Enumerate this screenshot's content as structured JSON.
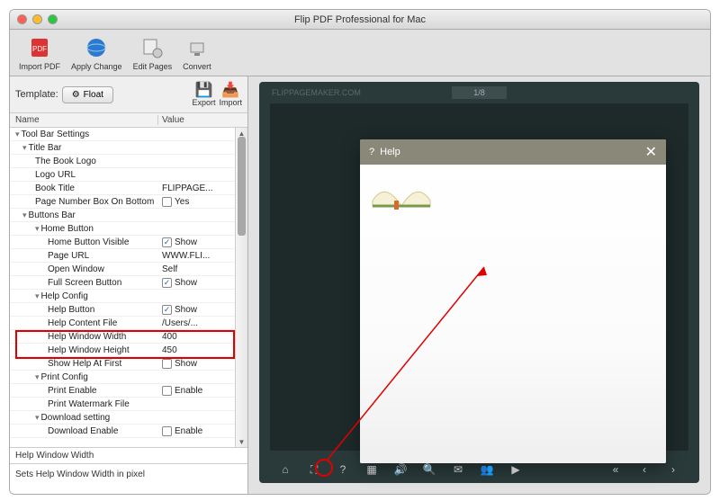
{
  "window": {
    "title": "Flip PDF Professional for Mac"
  },
  "toolbar": [
    {
      "name": "import-pdf",
      "label": "Import PDF",
      "iconColor": "#d33"
    },
    {
      "name": "apply-change",
      "label": "Apply Change",
      "iconColor": "#2a7ad3"
    },
    {
      "name": "edit-pages",
      "label": "Edit Pages",
      "iconColor": "#7a7a7a"
    },
    {
      "name": "convert",
      "label": "Convert",
      "iconColor": "#7a7a7a"
    }
  ],
  "template": {
    "label": "Template:",
    "current": "Float",
    "export": "Export",
    "import": "Import"
  },
  "tree": {
    "headers": {
      "name": "Name",
      "value": "Value"
    },
    "rows": [
      {
        "name": "Tool Bar Settings",
        "indent": 0,
        "expander": "open"
      },
      {
        "name": "Title Bar",
        "indent": 1,
        "expander": "open"
      },
      {
        "name": "The Book Logo",
        "indent": 2
      },
      {
        "name": "Logo URL",
        "indent": 2
      },
      {
        "name": "Book Title",
        "indent": 2,
        "value": "FLIPPAGE..."
      },
      {
        "name": "Page Number Box On Bottom",
        "indent": 2,
        "checkbox": false,
        "checklabel": "Yes"
      },
      {
        "name": "Buttons Bar",
        "indent": 1,
        "expander": "open"
      },
      {
        "name": "Home Button",
        "indent": 2,
        "expander": "open"
      },
      {
        "name": "Home Button Visible",
        "indent": 3,
        "checkbox": true,
        "checklabel": "Show"
      },
      {
        "name": "Page URL",
        "indent": 3,
        "value": "WWW.FLI..."
      },
      {
        "name": "Open Window",
        "indent": 3,
        "value": "Self"
      },
      {
        "name": "Full Screen Button",
        "indent": 3,
        "checkbox": true,
        "checklabel": "Show"
      },
      {
        "name": "Help Config",
        "indent": 2,
        "expander": "open"
      },
      {
        "name": "Help Button",
        "indent": 3,
        "checkbox": true,
        "checklabel": "Show"
      },
      {
        "name": "Help Content File",
        "indent": 3,
        "value": "/Users/..."
      },
      {
        "name": "Help Window Width",
        "indent": 3,
        "value": "400"
      },
      {
        "name": "Help Window Height",
        "indent": 3,
        "value": "450"
      },
      {
        "name": "Show Help At First",
        "indent": 3,
        "checkbox": false,
        "checklabel": "Show"
      },
      {
        "name": "Print Config",
        "indent": 2,
        "expander": "open"
      },
      {
        "name": "Print Enable",
        "indent": 3,
        "checkbox": false,
        "checklabel": "Enable"
      },
      {
        "name": "Print Watermark File",
        "indent": 3
      },
      {
        "name": "Download setting",
        "indent": 2,
        "expander": "open"
      },
      {
        "name": "Download Enable",
        "indent": 3,
        "checkbox": false,
        "checklabel": "Enable"
      }
    ]
  },
  "helpInfo": {
    "name": "Help Window Width",
    "desc": "Sets Help Window Width in pixel"
  },
  "preview": {
    "brand": "FLIPPAGEMAKER.COM",
    "pageIndicator": "1/8",
    "dialog": {
      "title": "Help",
      "questionPrefix": "?"
    },
    "bottomIcons": [
      "home",
      "expand",
      "help",
      "grid",
      "sound",
      "zoom",
      "mail",
      "share",
      "play"
    ],
    "navIcons": [
      "first",
      "prev",
      "next"
    ]
  }
}
